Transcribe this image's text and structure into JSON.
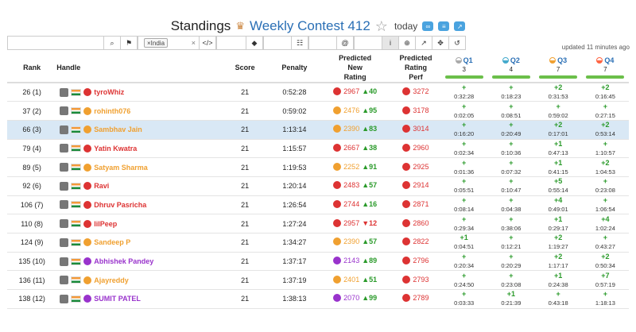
{
  "header": {
    "title": "Standings",
    "contest": "Weekly Contest 412",
    "today": "today"
  },
  "toolbar": {
    "search_placeholder": "",
    "country_tag": "India",
    "updated": "updated 11 minutes ago"
  },
  "table": {
    "headers": {
      "rank": "Rank",
      "handle": "Handle",
      "score": "Score",
      "penalty": "Penalty",
      "pred_new": [
        "Predicted",
        "New",
        "Rating"
      ],
      "pred_perf": [
        "Predicted",
        "Rating",
        "Perf"
      ]
    },
    "questions": [
      {
        "label": "Q1",
        "count": "3",
        "color": "#aaaaaa"
      },
      {
        "label": "Q2",
        "count": "4",
        "color": "#44aacc"
      },
      {
        "label": "Q3",
        "count": "7",
        "color": "#f0a030"
      },
      {
        "label": "Q4",
        "count": "7",
        "color": "#ff6644"
      }
    ],
    "rows": [
      {
        "rank": "26 (1)",
        "handle": "tyroWhiz",
        "color": "#d33",
        "score": "21",
        "penalty": "0:52:28",
        "new": "2967",
        "delta": "▲40",
        "dir": "up",
        "perf": "3272",
        "q": [
          [
            "+",
            "0:32:28"
          ],
          [
            "+",
            "0:18:23"
          ],
          [
            "+2",
            "0:31:53"
          ],
          [
            "+2",
            "0:16:45"
          ]
        ]
      },
      {
        "rank": "37 (2)",
        "handle": "rohinth076",
        "color": "#f0a030",
        "score": "21",
        "penalty": "0:59:02",
        "new": "2476",
        "delta": "▲95",
        "dir": "up",
        "perf": "3178",
        "q": [
          [
            "+",
            "0:02:05"
          ],
          [
            "+",
            "0:08:51"
          ],
          [
            "+",
            "0:59:02"
          ],
          [
            "+",
            "0:27:15"
          ]
        ]
      },
      {
        "rank": "66 (3)",
        "handle": "Sambhav Jain",
        "color": "#f0a030",
        "score": "21",
        "penalty": "1:13:14",
        "new": "2390",
        "delta": "▲83",
        "dir": "up",
        "perf": "3014",
        "q": [
          [
            "+",
            "0:16:20"
          ],
          [
            "+",
            "0:20:49"
          ],
          [
            "+2",
            "0:17:01"
          ],
          [
            "+2",
            "0:53:14"
          ]
        ]
      },
      {
        "rank": "79 (4)",
        "handle": "Yatin Kwatra",
        "color": "#d33",
        "score": "21",
        "penalty": "1:15:57",
        "new": "2667",
        "delta": "▲38",
        "dir": "up",
        "perf": "2960",
        "q": [
          [
            "+",
            "0:02:34"
          ],
          [
            "+",
            "0:10:36"
          ],
          [
            "+1",
            "0:47:13"
          ],
          [
            "+",
            "1:10:57"
          ]
        ]
      },
      {
        "rank": "89 (5)",
        "handle": "Satyam Sharma",
        "color": "#f0a030",
        "score": "21",
        "penalty": "1:19:53",
        "new": "2252",
        "delta": "▲91",
        "dir": "up",
        "perf": "2925",
        "q": [
          [
            "+",
            "0:01:36"
          ],
          [
            "+",
            "0:07:32"
          ],
          [
            "+1",
            "0:41:15"
          ],
          [
            "+2",
            "1:04:53"
          ]
        ]
      },
      {
        "rank": "92 (6)",
        "handle": "Ravi",
        "color": "#d33",
        "score": "21",
        "penalty": "1:20:14",
        "new": "2483",
        "delta": "▲57",
        "dir": "up",
        "perf": "2914",
        "q": [
          [
            "+",
            "0:05:51"
          ],
          [
            "+",
            "0:10:47"
          ],
          [
            "+5",
            "0:55:14"
          ],
          [
            "+",
            "0:23:08"
          ]
        ]
      },
      {
        "rank": "106 (7)",
        "handle": "Dhruv Pasricha",
        "color": "#d33",
        "score": "21",
        "penalty": "1:26:54",
        "new": "2744",
        "delta": "▲16",
        "dir": "up",
        "perf": "2871",
        "q": [
          [
            "+",
            "0:08:14"
          ],
          [
            "+",
            "0:04:38"
          ],
          [
            "+4",
            "0:49:01"
          ],
          [
            "+",
            "1:06:54"
          ]
        ]
      },
      {
        "rank": "110 (8)",
        "handle": "lilPeep",
        "color": "#d33",
        "score": "21",
        "penalty": "1:27:24",
        "new": "2957",
        "delta": "▼12",
        "dir": "down",
        "perf": "2860",
        "q": [
          [
            "+",
            "0:29:34"
          ],
          [
            "+",
            "0:38:06"
          ],
          [
            "+1",
            "0:29:17"
          ],
          [
            "+4",
            "1:02:24"
          ]
        ]
      },
      {
        "rank": "124 (9)",
        "handle": "Sandeep P",
        "color": "#f0a030",
        "score": "21",
        "penalty": "1:34:27",
        "new": "2390",
        "delta": "▲57",
        "dir": "up",
        "perf": "2822",
        "q": [
          [
            "+1",
            "0:04:51"
          ],
          [
            "+",
            "0:12:21"
          ],
          [
            "+2",
            "1:19:27"
          ],
          [
            "+",
            "0:43:27"
          ]
        ]
      },
      {
        "rank": "135 (10)",
        "handle": "Abhishek Pandey",
        "color": "#9933cc",
        "score": "21",
        "penalty": "1:37:17",
        "new": "2143",
        "delta": "▲89",
        "dir": "up",
        "perf": "2796",
        "q": [
          [
            "+",
            "0:20:34"
          ],
          [
            "+",
            "0:20:29"
          ],
          [
            "+2",
            "1:17:17"
          ],
          [
            "+2",
            "0:50:34"
          ]
        ]
      },
      {
        "rank": "136 (11)",
        "handle": "Ajayreddy",
        "color": "#f0a030",
        "score": "21",
        "penalty": "1:37:19",
        "new": "2401",
        "delta": "▲51",
        "dir": "up",
        "perf": "2793",
        "q": [
          [
            "+",
            "0:24:50"
          ],
          [
            "+",
            "0:23:08"
          ],
          [
            "+1",
            "0:24:38"
          ],
          [
            "+7",
            "0:57:19"
          ]
        ]
      },
      {
        "rank": "138 (12)",
        "handle": "SUMIT PATEL",
        "color": "#9933cc",
        "score": "21",
        "penalty": "1:38:13",
        "new": "2070",
        "delta": "▲99",
        "dir": "up",
        "perf": "2789",
        "q": [
          [
            "+",
            "0:03:33"
          ],
          [
            "+1",
            "0:21:39"
          ],
          [
            "+",
            "0:43:18"
          ],
          [
            "+",
            "1:18:13"
          ]
        ]
      }
    ]
  }
}
